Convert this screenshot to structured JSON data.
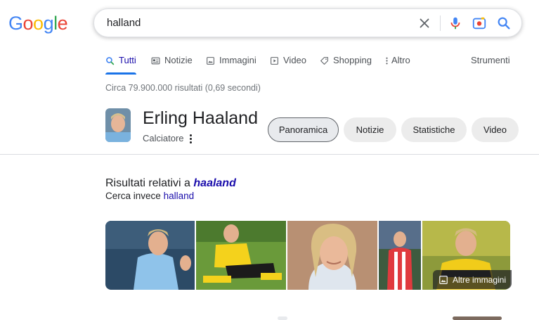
{
  "logo": {
    "letters": [
      "G",
      "o",
      "o",
      "g",
      "l",
      "e"
    ],
    "colors": [
      "#4285F4",
      "#EA4335",
      "#FBBC05",
      "#4285F4",
      "#34A853",
      "#EA4335"
    ]
  },
  "search": {
    "query": "halland",
    "icons": [
      "clear-icon",
      "microphone-icon",
      "camera-lens-icon",
      "search-icon"
    ]
  },
  "tabs": [
    {
      "label": "Tutti",
      "icon": "search-icon",
      "active": true
    },
    {
      "label": "Notizie",
      "icon": "news-icon",
      "active": false
    },
    {
      "label": "Immagini",
      "icon": "image-icon",
      "active": false
    },
    {
      "label": "Video",
      "icon": "video-icon",
      "active": false
    },
    {
      "label": "Shopping",
      "icon": "tag-icon",
      "active": false
    },
    {
      "label": "Altro",
      "icon": "more-vert-icon",
      "active": false
    }
  ],
  "tools_label": "Strumenti",
  "result_stats": "Circa 79.900.000 risultati (0,69 secondi)",
  "entity": {
    "name": "Erling Haaland",
    "subtitle": "Calciatore",
    "chips": [
      "Panoramica",
      "Notizie",
      "Statistiche",
      "Video"
    ],
    "selected_chip": "Panoramica"
  },
  "spelling": {
    "prefix": "Risultati relativi a",
    "corrected": "haaland",
    "instead_prefix": "Cerca invece",
    "instead_link": "halland"
  },
  "images": {
    "more_label": "Altre immagini",
    "tiles": [
      "haaland-manchester-city",
      "haaland-dortmund-sitting",
      "haaland-portrait-smile",
      "haaland-salzburg",
      "haaland-dortmund-yellow"
    ]
  },
  "colors": {
    "link": "#1a0dab",
    "accent": "#1a73e8"
  }
}
